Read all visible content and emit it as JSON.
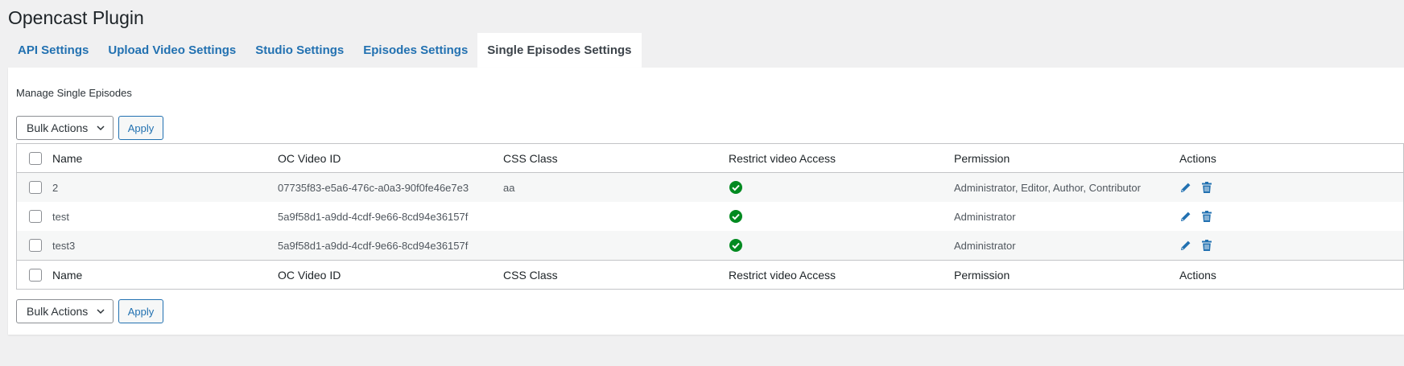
{
  "page_title": "Opencast Plugin",
  "tabs": [
    {
      "label": "API Settings",
      "active": false
    },
    {
      "label": "Upload Video Settings",
      "active": false
    },
    {
      "label": "Studio Settings",
      "active": false
    },
    {
      "label": "Episodes Settings",
      "active": false
    },
    {
      "label": "Single Episodes Settings",
      "active": true
    }
  ],
  "panel": {
    "description": "Manage Single Episodes",
    "bulk_actions": {
      "selected": "Bulk Actions",
      "apply_label": "Apply"
    },
    "table": {
      "columns": [
        "Name",
        "OC Video ID",
        "CSS Class",
        "Restrict video Access",
        "Permission",
        "Actions"
      ],
      "rows": [
        {
          "name": "2",
          "oc_video_id": "07735f83-e5a6-476c-a0a3-90f0fe46e7e3",
          "css_class": "aa",
          "restrict": "check-circle-icon",
          "permission": "Administrator, Editor, Author, Contributor"
        },
        {
          "name": "test",
          "oc_video_id": "5a9f58d1-a9dd-4cdf-9e66-8cd94e36157f",
          "css_class": "",
          "restrict": "check-circle-icon",
          "permission": "Administrator"
        },
        {
          "name": "test3",
          "oc_video_id": "5a9f58d1-a9dd-4cdf-9e66-8cd94e36157f",
          "css_class": "",
          "restrict": "check-circle-icon",
          "permission": "Administrator"
        }
      ],
      "row_actions": [
        "edit-pencil-icon",
        "delete-trash-icon"
      ]
    }
  },
  "colors": {
    "link": "#2271b1",
    "check": "#008a20",
    "background": "#f0f0f1"
  }
}
